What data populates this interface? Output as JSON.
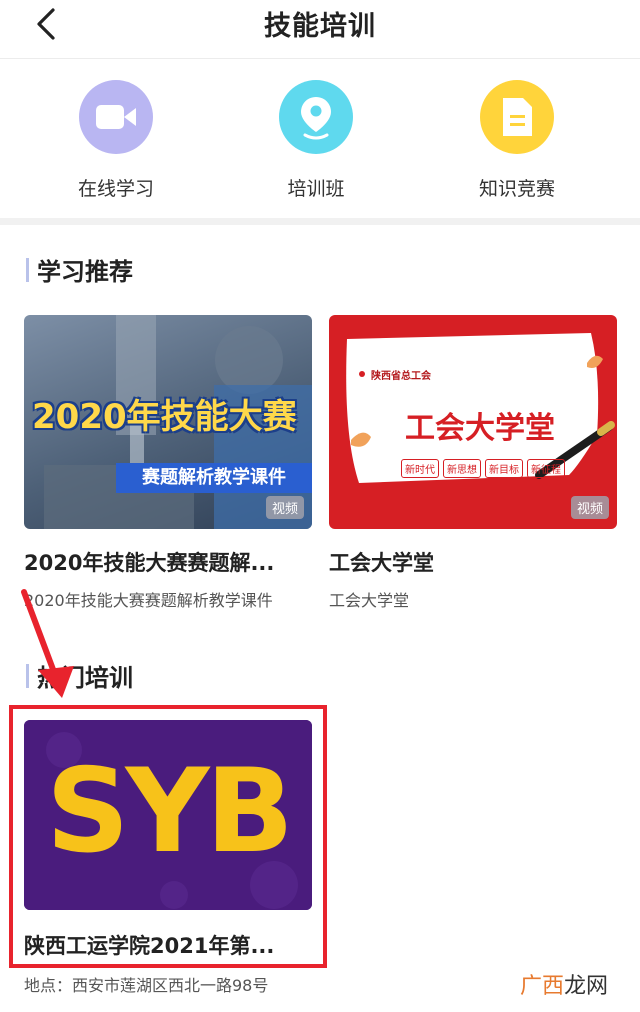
{
  "header": {
    "title": "技能培训"
  },
  "nav": [
    {
      "label": "在线学习",
      "icon": "video-camera-icon",
      "color": "#b9b6f2"
    },
    {
      "label": "培训班",
      "icon": "location-pin-icon",
      "color": "#5fd9ee"
    },
    {
      "label": "知识竞赛",
      "icon": "document-icon",
      "color": "#ffd43b"
    }
  ],
  "sections": {
    "recommend": "学习推荐",
    "hot": "热门培训"
  },
  "recommend_cards": [
    {
      "thumb_main": "2020年技能大赛",
      "thumb_banner": "赛题解析教学课件",
      "badge": "视频",
      "title": "2020年技能大赛赛题解...",
      "subtitle": "2020年技能大赛赛题解析教学课件"
    },
    {
      "thumb_org": "陕西省总工会",
      "thumb_main": "工会大学堂",
      "thumb_tags": [
        "新时代",
        "新思想",
        "新目标",
        "新征程"
      ],
      "badge": "视频",
      "title": "工会大学堂",
      "subtitle": "工会大学堂"
    }
  ],
  "hot_card": {
    "thumb_text": "SYB",
    "title": "陕西工运学院2021年第...",
    "location": "地点：西安市莲湖区西北一路98号"
  },
  "watermark": {
    "part_a": "广西",
    "part_b": "龙网"
  },
  "colors": {
    "annotation_red": "#e8232d",
    "section_bar": "#b9c2ea"
  }
}
